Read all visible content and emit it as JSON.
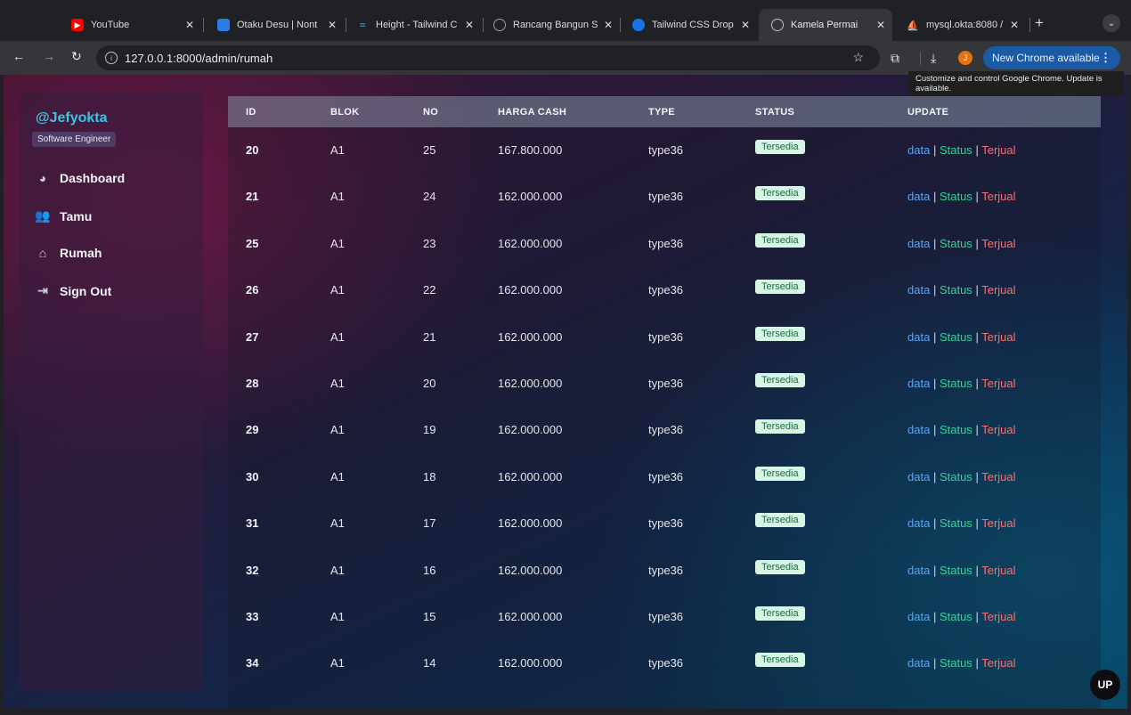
{
  "browser": {
    "tabs": [
      {
        "title": "YouTube",
        "favicon": "youtube-icon",
        "color": "#ff0000",
        "active": false
      },
      {
        "title": "Otaku Desu | Nont",
        "favicon": "otaku-icon",
        "color": "#2d7be5",
        "active": false
      },
      {
        "title": "Height - Tailwind C",
        "favicon": "tailwind-icon",
        "color": "#38bdf8",
        "active": false
      },
      {
        "title": "Rancang Bangun S",
        "favicon": "globe-icon",
        "color": "#9aa0a6",
        "active": false
      },
      {
        "title": "Tailwind CSS Drop",
        "favicon": "flowbite-icon",
        "color": "#1a73e8",
        "active": false
      },
      {
        "title": "Kamela Permai",
        "favicon": "globe-icon",
        "color": "#9aa0a6",
        "active": true
      },
      {
        "title": "mysql.okta:8080 /",
        "favicon": "phpmyadmin-icon",
        "color": "#f29c1f",
        "active": false
      }
    ],
    "url": "127.0.0.1:8000/admin/rumah",
    "profile_initial": "J",
    "update_button": "New Chrome available",
    "tooltip": "Customize and control Google Chrome. Update is available."
  },
  "sidebar": {
    "brand": "@Jefyokta",
    "role": "Software Engineer",
    "items": [
      {
        "label": "Dashboard",
        "icon": "pie-chart-icon"
      },
      {
        "label": "Tamu",
        "icon": "users-icon"
      },
      {
        "label": "Rumah",
        "icon": "home-icon"
      },
      {
        "label": "Sign Out",
        "icon": "sign-out-icon"
      }
    ]
  },
  "table": {
    "headers": [
      "ID",
      "BLOK",
      "NO",
      "HARGA CASH",
      "TYPE",
      "STATUS",
      "UPDATE"
    ],
    "rows": [
      {
        "id": "20",
        "blok": "A1",
        "no": "25",
        "harga": "167.800.000",
        "type": "type36",
        "status": "Tersedia"
      },
      {
        "id": "21",
        "blok": "A1",
        "no": "24",
        "harga": "162.000.000",
        "type": "type36",
        "status": "Tersedia"
      },
      {
        "id": "25",
        "blok": "A1",
        "no": "23",
        "harga": "162.000.000",
        "type": "type36",
        "status": "Tersedia"
      },
      {
        "id": "26",
        "blok": "A1",
        "no": "22",
        "harga": "162.000.000",
        "type": "type36",
        "status": "Tersedia"
      },
      {
        "id": "27",
        "blok": "A1",
        "no": "21",
        "harga": "162.000.000",
        "type": "type36",
        "status": "Tersedia"
      },
      {
        "id": "28",
        "blok": "A1",
        "no": "20",
        "harga": "162.000.000",
        "type": "type36",
        "status": "Tersedia"
      },
      {
        "id": "29",
        "blok": "A1",
        "no": "19",
        "harga": "162.000.000",
        "type": "type36",
        "status": "Tersedia"
      },
      {
        "id": "30",
        "blok": "A1",
        "no": "18",
        "harga": "162.000.000",
        "type": "type36",
        "status": "Tersedia"
      },
      {
        "id": "31",
        "blok": "A1",
        "no": "17",
        "harga": "162.000.000",
        "type": "type36",
        "status": "Tersedia"
      },
      {
        "id": "32",
        "blok": "A1",
        "no": "16",
        "harga": "162.000.000",
        "type": "type36",
        "status": "Tersedia"
      },
      {
        "id": "33",
        "blok": "A1",
        "no": "15",
        "harga": "162.000.000",
        "type": "type36",
        "status": "Tersedia"
      },
      {
        "id": "34",
        "blok": "A1",
        "no": "14",
        "harga": "162.000.000",
        "type": "type36",
        "status": "Tersedia"
      }
    ],
    "update_links": {
      "data": "data",
      "status": "Status",
      "terjual": "Terjual",
      "separator": "|"
    },
    "status_colors": {
      "badge_bg": "#d7f5e4",
      "badge_text": "#1a6b43",
      "data": "#5ba6f4",
      "status": "#34d399",
      "terjual": "#f87171"
    }
  },
  "up_button": "UP"
}
